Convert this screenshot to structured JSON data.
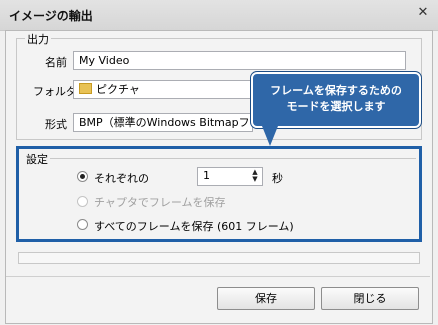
{
  "window": {
    "title": "イメージの輸出",
    "close_glyph": "✕"
  },
  "output": {
    "legend": "出力",
    "name_label": "名前",
    "name_value": "My Video",
    "folder_label": "フォルダ",
    "folder_value": "ピクチャ",
    "format_label": "形式",
    "format_value": "BMP（標準のWindows Bitmapファイル)"
  },
  "callout": {
    "line1": "フレームを保存するための",
    "line2": "モードを選択します"
  },
  "settings": {
    "legend": "設定",
    "option_each": "それぞれの",
    "interval_value": "1",
    "interval_unit": "秒",
    "option_chapters": "チャプタでフレームを保存",
    "option_all": "すべてのフレームを保存 (601 フレーム)"
  },
  "buttons": {
    "save": "保存",
    "close": "閉じる"
  },
  "icons": {
    "folder": "folder-icon",
    "close": "close-icon",
    "spin_up": "▲",
    "spin_down": "▼"
  }
}
